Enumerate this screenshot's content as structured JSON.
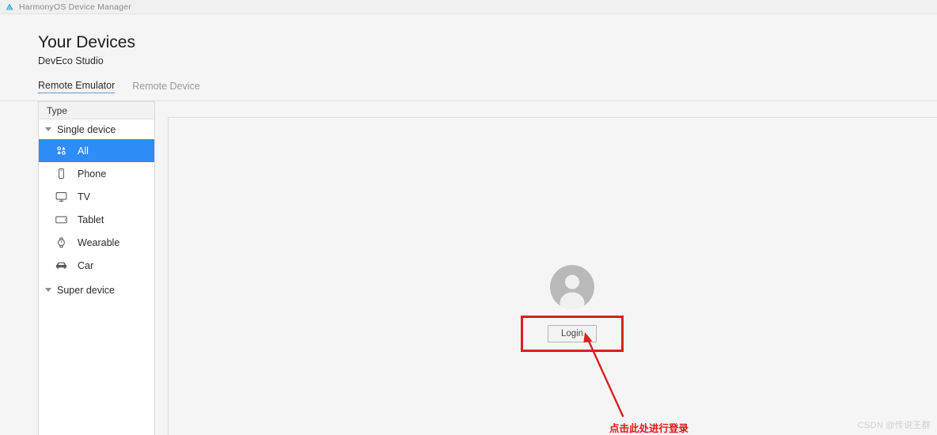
{
  "window": {
    "title": "HarmonyOS Device Manager",
    "icon": "harmonyos-logo-icon"
  },
  "page": {
    "heading": "Your Devices",
    "subheading": "DevEco Studio"
  },
  "tabs": [
    {
      "label": "Remote Emulator",
      "active": true
    },
    {
      "label": "Remote Device",
      "active": false
    }
  ],
  "sidebar": {
    "header": "Type",
    "groups": [
      {
        "label": "Single device",
        "expanded": true,
        "items": [
          {
            "label": "All",
            "icon": "grid-dots-icon",
            "selected": true
          },
          {
            "label": "Phone",
            "icon": "phone-icon",
            "selected": false
          },
          {
            "label": "TV",
            "icon": "tv-icon",
            "selected": false
          },
          {
            "label": "Tablet",
            "icon": "tablet-icon",
            "selected": false
          },
          {
            "label": "Wearable",
            "icon": "watch-icon",
            "selected": false
          },
          {
            "label": "Car",
            "icon": "car-icon",
            "selected": false
          }
        ]
      },
      {
        "label": "Super device",
        "expanded": true,
        "items": []
      }
    ]
  },
  "content": {
    "avatar_icon": "user-avatar-icon",
    "login_label": "Login"
  },
  "annotation": {
    "text": "点击此处进行登录",
    "arrow": "red-arrow-icon",
    "highlight_color": "#d92020"
  },
  "watermark": {
    "text": "CSDN @传说王群"
  },
  "colors": {
    "selection": "#2d8cf5",
    "annotation_red": "#e61414",
    "highlight_red": "#d92020",
    "tab_underline": "#6d96c6"
  }
}
